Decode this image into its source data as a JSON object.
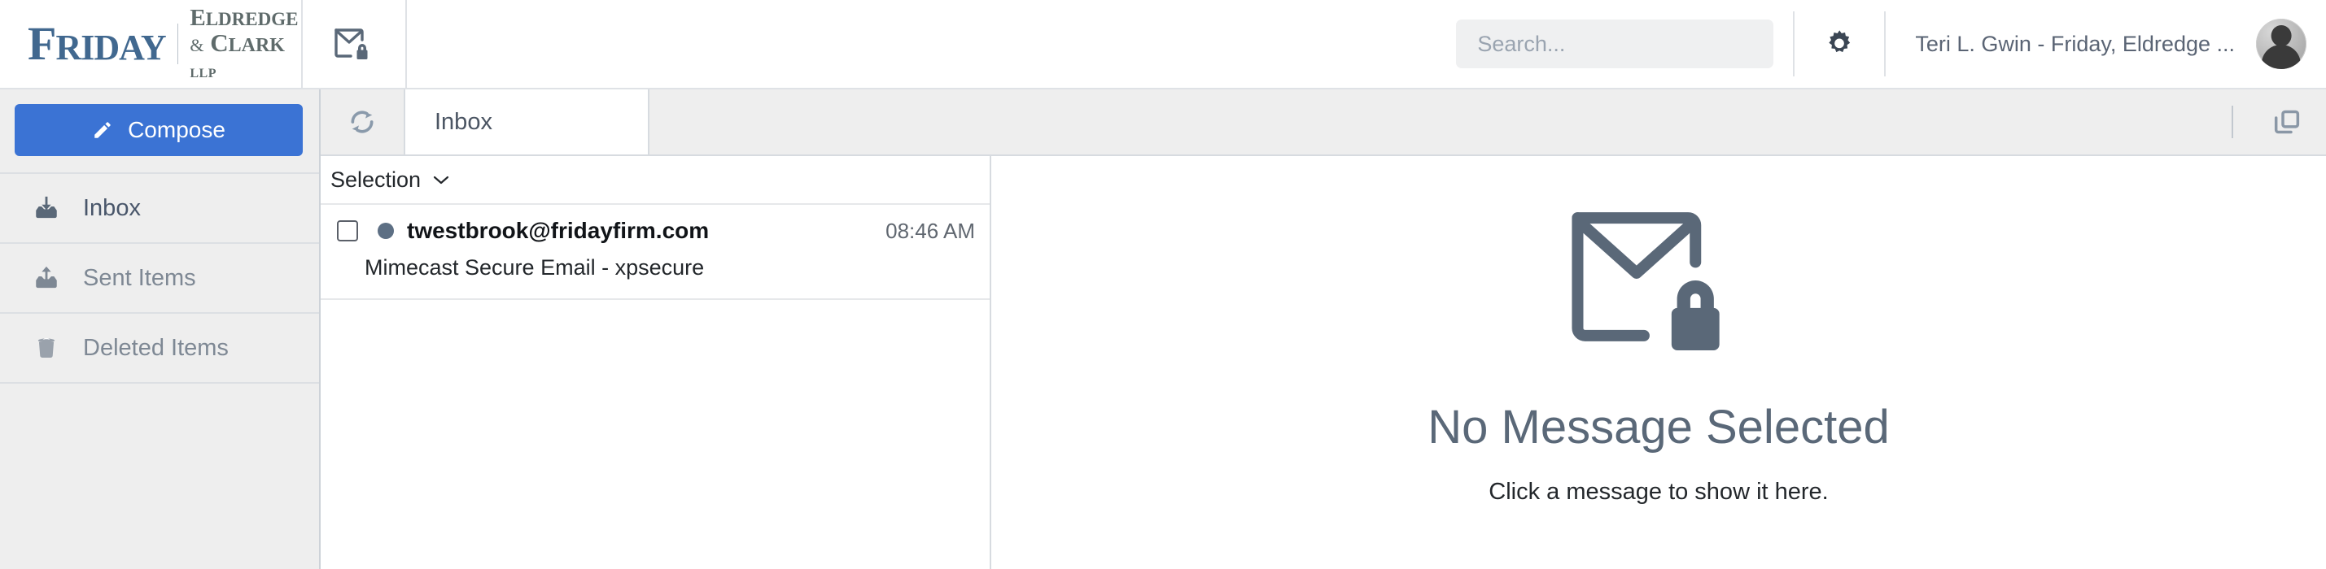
{
  "header": {
    "logo": {
      "friday": "FRIDAY",
      "eldredge": "ELDREDGE",
      "amp": "&",
      "clark": "CLARK",
      "llp": "LLP"
    },
    "secure_mail_icon": "envelope-lock-icon",
    "search": {
      "placeholder": "Search...",
      "value": "",
      "icon": "search-icon"
    },
    "settings_icon": "gear-icon",
    "user_name": "Teri L. Gwin - Friday, Eldredge ...",
    "avatar_icon": "user-avatar"
  },
  "sidebar": {
    "compose_label": "Compose",
    "compose_icon": "pencil-icon",
    "compose_color": "#3b73d4",
    "items": [
      {
        "label": "Inbox",
        "icon": "inbox-icon",
        "active": true
      },
      {
        "label": "Sent Items",
        "icon": "sent-icon",
        "active": false
      },
      {
        "label": "Deleted Items",
        "icon": "trash-icon",
        "active": false
      }
    ]
  },
  "toolbar": {
    "refresh_icon": "refresh-icon",
    "tab_label": "Inbox",
    "window_icon": "restore-window-icon"
  },
  "message_list": {
    "selection_label": "Selection",
    "selection_chevron": "chevron-down-icon",
    "messages": [
      {
        "sender": "twestbrook@fridayfirm.com",
        "time": "08:46 AM",
        "subject": "Mimecast Secure Email - xpsecure",
        "unread": true,
        "checked": false
      }
    ]
  },
  "reading_pane": {
    "icon": "envelope-lock-icon",
    "title": "No Message Selected",
    "subtitle": "Click a message to show it here."
  },
  "colors": {
    "accent": "#3b73d4",
    "logo_blue": "#41688f",
    "logo_gray": "#5f6b6b",
    "icon_slate": "#5a6878",
    "sidebar_bg": "#eeeeee"
  }
}
